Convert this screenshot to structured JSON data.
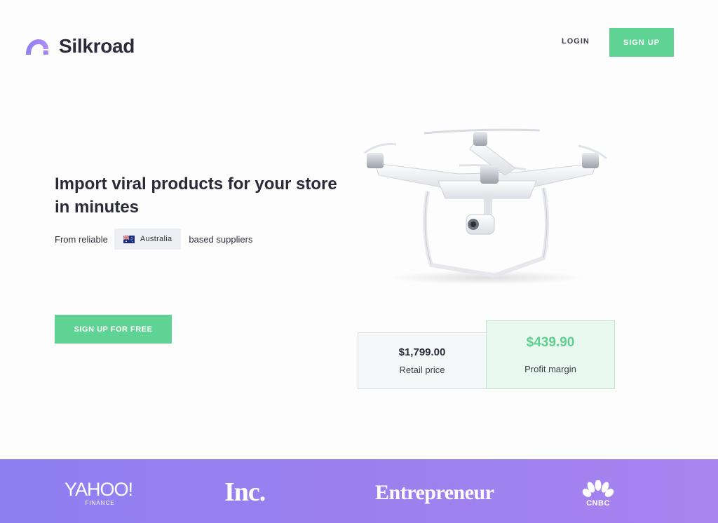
{
  "header": {
    "brand": "Silkroad",
    "login_label": "LOGIN",
    "signup_label": "SIGN UP"
  },
  "hero": {
    "headline": "Import viral products for your store in minutes",
    "subline_prefix": "From reliable",
    "country": "Australia",
    "subline_suffix": "based suppliers",
    "cta_label": "SIGN UP FOR FREE"
  },
  "product": {
    "image": "drone-image",
    "retail_price": "$1,799.00",
    "retail_label": "Retail price",
    "profit_value": "$439.90",
    "profit_label": "Profit margin"
  },
  "press": {
    "yahoo_main": "YAHOO!",
    "yahoo_sub": "FINANCE",
    "inc": "Inc.",
    "entrepreneur": "Entrepreneur",
    "cnbc": "CNBC"
  },
  "colors": {
    "accent_green": "#5fd394",
    "brand_purple": "#9a80ee"
  }
}
